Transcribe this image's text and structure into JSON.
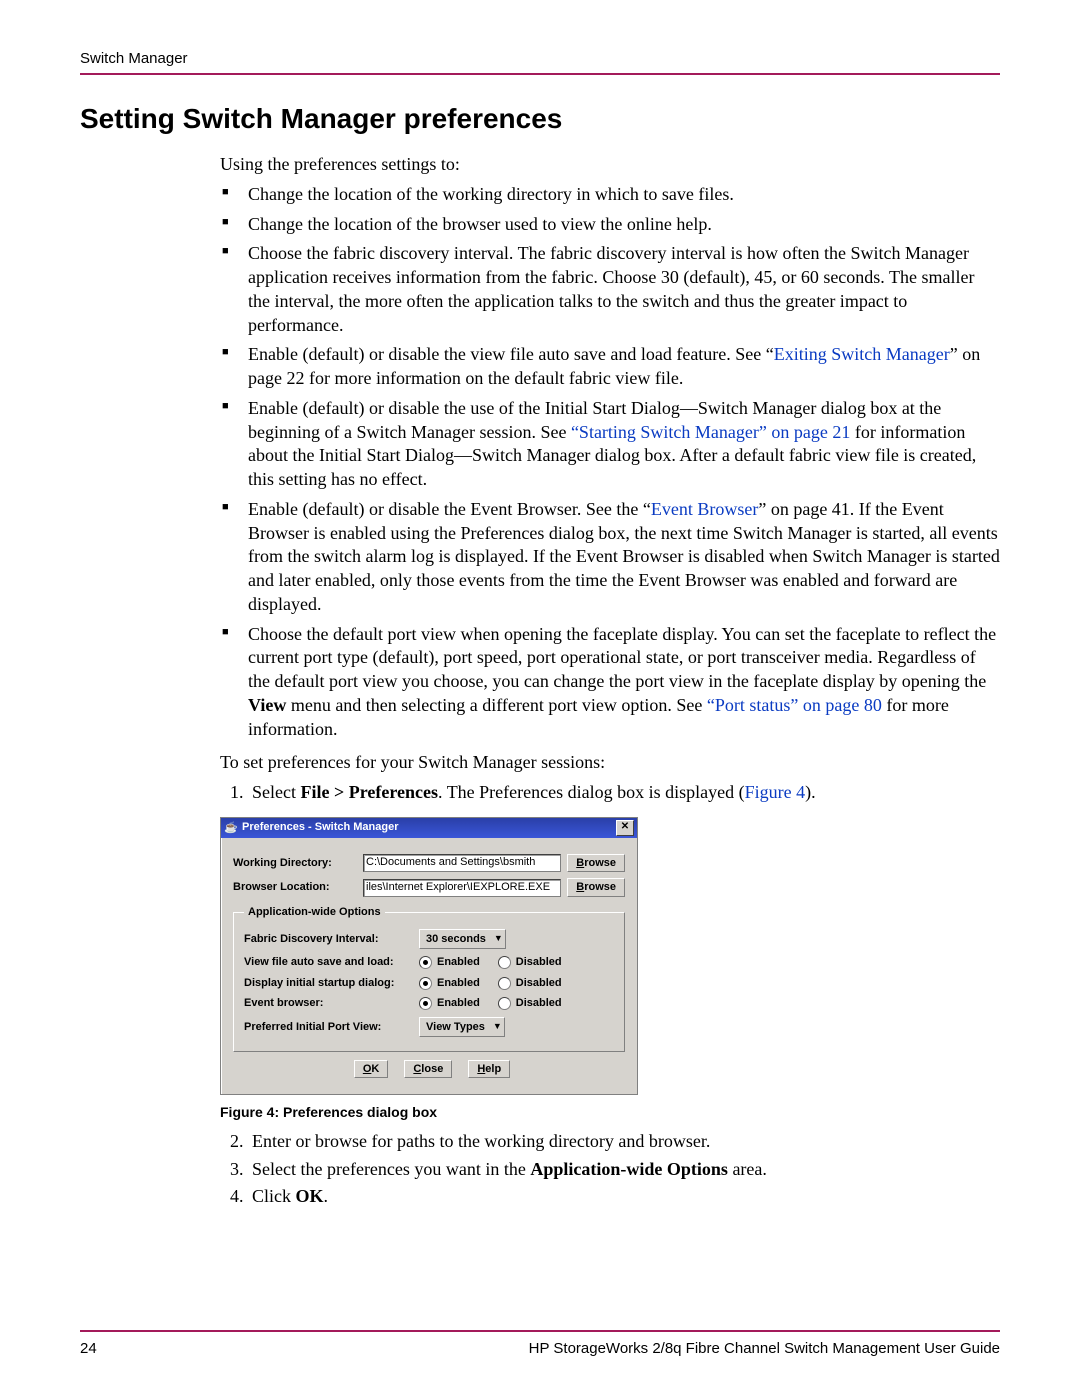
{
  "header": {
    "running": "Switch Manager"
  },
  "title": "Setting Switch Manager preferences",
  "intro": "Using the preferences settings to:",
  "bullets": [
    {
      "text": "Change the location of the working directory in which to save files."
    },
    {
      "text": "Change the location of the browser used to view the online help."
    },
    {
      "text": "Choose the fabric discovery interval. The fabric discovery interval is how often the Switch Manager application receives information from the fabric. Choose 30 (default), 45, or 60 seconds. The smaller the interval, the more often the application talks to the switch and thus the greater impact to performance."
    },
    {
      "pre": "Enable (default) or disable the view file auto save and load feature. See “",
      "link": "Exiting Switch Manager",
      "post": "” on page 22 for more information on the default fabric view file."
    },
    {
      "pre": "Enable (default) or disable the use of the Initial Start Dialog—Switch Manager dialog box at the beginning of a Switch Manager session. See ",
      "link": "“Starting Switch Manager” on page 21",
      "post": " for information about the Initial Start Dialog—Switch Manager dialog box. After a default fabric view file is created, this setting has no effect."
    },
    {
      "pre": "Enable (default) or disable the Event Browser. See the “",
      "link": "Event Browser",
      "post": "” on page 41. If the Event Browser is enabled using the Preferences dialog box, the next time Switch Manager is started, all events from the switch alarm log is displayed. If the Event Browser is disabled when Switch Manager is started and later enabled, only those events from the time the Event Browser was enabled and forward are displayed."
    },
    {
      "pre": "Choose the default port view when opening the faceplate display. You can set the faceplate to reflect the current port type (default), port speed, port operational state, or port transceiver media. Regardless of the default port view you choose, you can change the port view in the faceplate display by opening the ",
      "bold1": "View",
      "mid": " menu and then selecting a different port view option. See ",
      "link": "“Port status” on page 80",
      "post": " for more information."
    }
  ],
  "steps_intro": "To set preferences for your Switch Manager sessions:",
  "step1": {
    "pre": "Select ",
    "bold": "File > Preferences",
    "mid": ". The Preferences dialog box is displayed (",
    "link": "Figure 4",
    "post": ")."
  },
  "dialog": {
    "title": "Preferences - Switch Manager",
    "wd_label": "Working Directory:",
    "wd_value": "C:\\Documents and Settings\\bsmith",
    "bl_label": "Browser Location:",
    "bl_value": "iles\\Internet Explorer\\IEXPLORE.EXE",
    "browse": "Browse",
    "group_label": "Application-wide Options",
    "fdi_label": "Fabric Discovery Interval:",
    "fdi_value": "30 seconds",
    "auto_label": "View file auto save and load:",
    "init_label": "Display initial startup dialog:",
    "eb_label": "Event browser:",
    "port_label": "Preferred Initial Port View:",
    "port_value": "View Types",
    "enabled": "Enabled",
    "disabled": "Disabled",
    "ok": "OK",
    "close": "Close",
    "help": "Help"
  },
  "figure_caption": "Figure 4:  Preferences dialog box",
  "step2": "Enter or browse for paths to the working directory and browser.",
  "step3": {
    "pre": "Select the preferences you want in the ",
    "bold": "Application-wide Options",
    "post": " area."
  },
  "step4": {
    "pre": "Click ",
    "bold": "OK",
    "post": "."
  },
  "footer": {
    "page": "24",
    "doc": "HP StorageWorks 2/8q Fibre Channel Switch Management User Guide"
  }
}
